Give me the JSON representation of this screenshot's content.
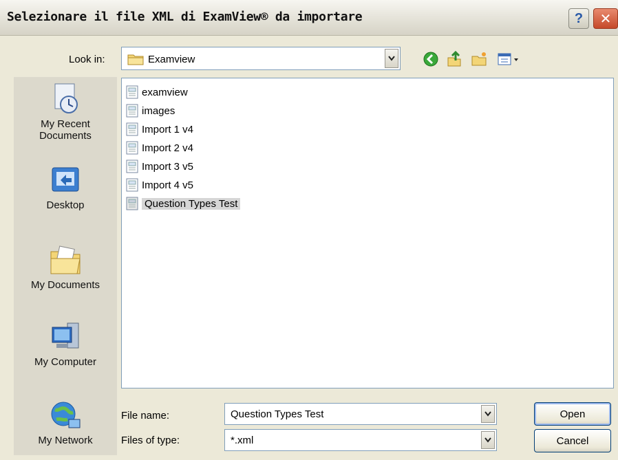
{
  "window": {
    "title": "Selezionare il file XML di ExamView® da importare",
    "help_label": "?",
    "close_label": "✕"
  },
  "toolbar": {
    "lookin_label": "Look in:",
    "lookin_value": "Examview",
    "icons": [
      "back-icon",
      "up-folder-icon",
      "new-folder-icon",
      "views-menu-icon"
    ]
  },
  "places": [
    {
      "label": "My Recent Documents"
    },
    {
      "label": "Desktop"
    },
    {
      "label": "My Documents"
    },
    {
      "label": "My Computer"
    },
    {
      "label": "My Network"
    }
  ],
  "files": [
    {
      "name": "examview"
    },
    {
      "name": "images"
    },
    {
      "name": "Import 1 v4"
    },
    {
      "name": "Import 2 v4"
    },
    {
      "name": "Import 3 v5"
    },
    {
      "name": "Import 4 v5"
    },
    {
      "name": "Question Types Test",
      "selected": true
    }
  ],
  "form": {
    "filename_label": "File name:",
    "filename_value": "Question Types Test",
    "filetype_label": "Files of type:",
    "filetype_value": "*.xml"
  },
  "buttons": {
    "open": "Open",
    "cancel": "Cancel"
  }
}
